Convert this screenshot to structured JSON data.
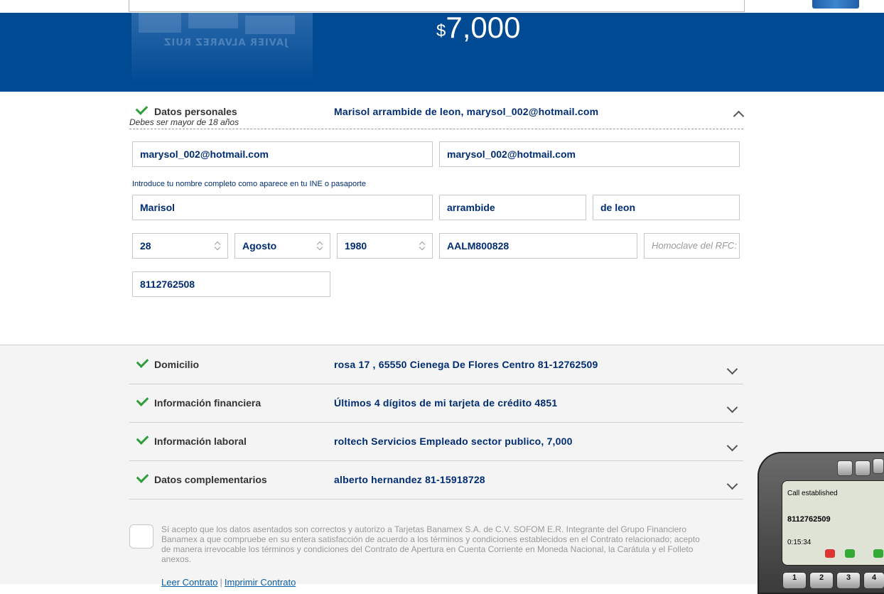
{
  "hero": {
    "currency": "$",
    "amount": "7,000",
    "art_text": "JAVIER ALVAREZ RUIZ"
  },
  "sections": {
    "personal": {
      "title": "Datos personales",
      "summary": "Marisol arrambide de leon, marysol_002@hotmail.com",
      "hint": "Debes ser mayor de 18 años",
      "name_note": "Introduce tu nombre completo como aparece en tu INE o pasaporte",
      "fields": {
        "email": "marysol_002@hotmail.com",
        "email_confirm": "marysol_002@hotmail.com",
        "first_name": "Marisol",
        "last_name_1": "arrambide",
        "last_name_2": "de leon",
        "birth_day": "28",
        "birth_month": "Agosto",
        "birth_year": "1980",
        "rfc": "AALM800828",
        "homoclave_placeholder": "Homoclave del RFC:",
        "phone": "8112762508"
      }
    },
    "collapsed": [
      {
        "title": "Domicilio",
        "summary": "rosa 17 , 65550 Cienega De Flores Centro 81-12762509"
      },
      {
        "title": "Información financiera",
        "summary": "Últimos 4 dígitos de mi tarjeta de crédito 4851"
      },
      {
        "title": "Información laboral",
        "summary": "roltech Servicios Empleado sector publico, 7,000"
      },
      {
        "title": "Datos complementarios",
        "summary": "alberto hernandez 81-15918728"
      }
    ]
  },
  "consent": {
    "text": "Sí acepto que los datos asentados son correctos y autorizo a Tarjetas Banamex S.A. de C.V. SOFOM E.R. Integrante del Grupo Financiero Banamex a que compruebe en su entera satisfacción de acuerdo a los términos y condiciones establecidos en el Contrato relacionado; acepto de manera irrevocable los términos y condiciones del Contrato de Apertura en Cuenta Corriente en Moneda Nacional, la Carátula y el Folleto anexos.",
    "read_link": "Leer Contrato",
    "separator": "|",
    "print_link": "Imprimir Contrato"
  },
  "phone_widget": {
    "status": "Call established",
    "number": "8112762509",
    "timer": "0:15:34",
    "keys": [
      "1",
      "2",
      "3",
      "4"
    ]
  },
  "colors": {
    "hero_blue": "#004a94",
    "text_navy": "#002d72",
    "check_green": "#2e9e3a"
  }
}
